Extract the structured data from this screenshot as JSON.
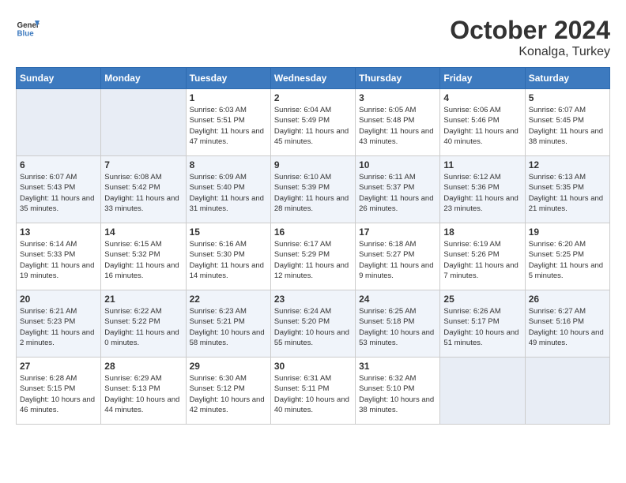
{
  "header": {
    "logo_line1": "General",
    "logo_line2": "Blue",
    "month": "October 2024",
    "location": "Konalga, Turkey"
  },
  "days_of_week": [
    "Sunday",
    "Monday",
    "Tuesday",
    "Wednesday",
    "Thursday",
    "Friday",
    "Saturday"
  ],
  "weeks": [
    [
      {
        "day": "",
        "empty": true
      },
      {
        "day": "",
        "empty": true
      },
      {
        "day": "1",
        "sunrise": "Sunrise: 6:03 AM",
        "sunset": "Sunset: 5:51 PM",
        "daylight": "Daylight: 11 hours and 47 minutes."
      },
      {
        "day": "2",
        "sunrise": "Sunrise: 6:04 AM",
        "sunset": "Sunset: 5:49 PM",
        "daylight": "Daylight: 11 hours and 45 minutes."
      },
      {
        "day": "3",
        "sunrise": "Sunrise: 6:05 AM",
        "sunset": "Sunset: 5:48 PM",
        "daylight": "Daylight: 11 hours and 43 minutes."
      },
      {
        "day": "4",
        "sunrise": "Sunrise: 6:06 AM",
        "sunset": "Sunset: 5:46 PM",
        "daylight": "Daylight: 11 hours and 40 minutes."
      },
      {
        "day": "5",
        "sunrise": "Sunrise: 6:07 AM",
        "sunset": "Sunset: 5:45 PM",
        "daylight": "Daylight: 11 hours and 38 minutes."
      }
    ],
    [
      {
        "day": "6",
        "sunrise": "Sunrise: 6:07 AM",
        "sunset": "Sunset: 5:43 PM",
        "daylight": "Daylight: 11 hours and 35 minutes."
      },
      {
        "day": "7",
        "sunrise": "Sunrise: 6:08 AM",
        "sunset": "Sunset: 5:42 PM",
        "daylight": "Daylight: 11 hours and 33 minutes."
      },
      {
        "day": "8",
        "sunrise": "Sunrise: 6:09 AM",
        "sunset": "Sunset: 5:40 PM",
        "daylight": "Daylight: 11 hours and 31 minutes."
      },
      {
        "day": "9",
        "sunrise": "Sunrise: 6:10 AM",
        "sunset": "Sunset: 5:39 PM",
        "daylight": "Daylight: 11 hours and 28 minutes."
      },
      {
        "day": "10",
        "sunrise": "Sunrise: 6:11 AM",
        "sunset": "Sunset: 5:37 PM",
        "daylight": "Daylight: 11 hours and 26 minutes."
      },
      {
        "day": "11",
        "sunrise": "Sunrise: 6:12 AM",
        "sunset": "Sunset: 5:36 PM",
        "daylight": "Daylight: 11 hours and 23 minutes."
      },
      {
        "day": "12",
        "sunrise": "Sunrise: 6:13 AM",
        "sunset": "Sunset: 5:35 PM",
        "daylight": "Daylight: 11 hours and 21 minutes."
      }
    ],
    [
      {
        "day": "13",
        "sunrise": "Sunrise: 6:14 AM",
        "sunset": "Sunset: 5:33 PM",
        "daylight": "Daylight: 11 hours and 19 minutes."
      },
      {
        "day": "14",
        "sunrise": "Sunrise: 6:15 AM",
        "sunset": "Sunset: 5:32 PM",
        "daylight": "Daylight: 11 hours and 16 minutes."
      },
      {
        "day": "15",
        "sunrise": "Sunrise: 6:16 AM",
        "sunset": "Sunset: 5:30 PM",
        "daylight": "Daylight: 11 hours and 14 minutes."
      },
      {
        "day": "16",
        "sunrise": "Sunrise: 6:17 AM",
        "sunset": "Sunset: 5:29 PM",
        "daylight": "Daylight: 11 hours and 12 minutes."
      },
      {
        "day": "17",
        "sunrise": "Sunrise: 6:18 AM",
        "sunset": "Sunset: 5:27 PM",
        "daylight": "Daylight: 11 hours and 9 minutes."
      },
      {
        "day": "18",
        "sunrise": "Sunrise: 6:19 AM",
        "sunset": "Sunset: 5:26 PM",
        "daylight": "Daylight: 11 hours and 7 minutes."
      },
      {
        "day": "19",
        "sunrise": "Sunrise: 6:20 AM",
        "sunset": "Sunset: 5:25 PM",
        "daylight": "Daylight: 11 hours and 5 minutes."
      }
    ],
    [
      {
        "day": "20",
        "sunrise": "Sunrise: 6:21 AM",
        "sunset": "Sunset: 5:23 PM",
        "daylight": "Daylight: 11 hours and 2 minutes."
      },
      {
        "day": "21",
        "sunrise": "Sunrise: 6:22 AM",
        "sunset": "Sunset: 5:22 PM",
        "daylight": "Daylight: 11 hours and 0 minutes."
      },
      {
        "day": "22",
        "sunrise": "Sunrise: 6:23 AM",
        "sunset": "Sunset: 5:21 PM",
        "daylight": "Daylight: 10 hours and 58 minutes."
      },
      {
        "day": "23",
        "sunrise": "Sunrise: 6:24 AM",
        "sunset": "Sunset: 5:20 PM",
        "daylight": "Daylight: 10 hours and 55 minutes."
      },
      {
        "day": "24",
        "sunrise": "Sunrise: 6:25 AM",
        "sunset": "Sunset: 5:18 PM",
        "daylight": "Daylight: 10 hours and 53 minutes."
      },
      {
        "day": "25",
        "sunrise": "Sunrise: 6:26 AM",
        "sunset": "Sunset: 5:17 PM",
        "daylight": "Daylight: 10 hours and 51 minutes."
      },
      {
        "day": "26",
        "sunrise": "Sunrise: 6:27 AM",
        "sunset": "Sunset: 5:16 PM",
        "daylight": "Daylight: 10 hours and 49 minutes."
      }
    ],
    [
      {
        "day": "27",
        "sunrise": "Sunrise: 6:28 AM",
        "sunset": "Sunset: 5:15 PM",
        "daylight": "Daylight: 10 hours and 46 minutes."
      },
      {
        "day": "28",
        "sunrise": "Sunrise: 6:29 AM",
        "sunset": "Sunset: 5:13 PM",
        "daylight": "Daylight: 10 hours and 44 minutes."
      },
      {
        "day": "29",
        "sunrise": "Sunrise: 6:30 AM",
        "sunset": "Sunset: 5:12 PM",
        "daylight": "Daylight: 10 hours and 42 minutes."
      },
      {
        "day": "30",
        "sunrise": "Sunrise: 6:31 AM",
        "sunset": "Sunset: 5:11 PM",
        "daylight": "Daylight: 10 hours and 40 minutes."
      },
      {
        "day": "31",
        "sunrise": "Sunrise: 6:32 AM",
        "sunset": "Sunset: 5:10 PM",
        "daylight": "Daylight: 10 hours and 38 minutes."
      },
      {
        "day": "",
        "empty": true
      },
      {
        "day": "",
        "empty": true
      }
    ]
  ]
}
